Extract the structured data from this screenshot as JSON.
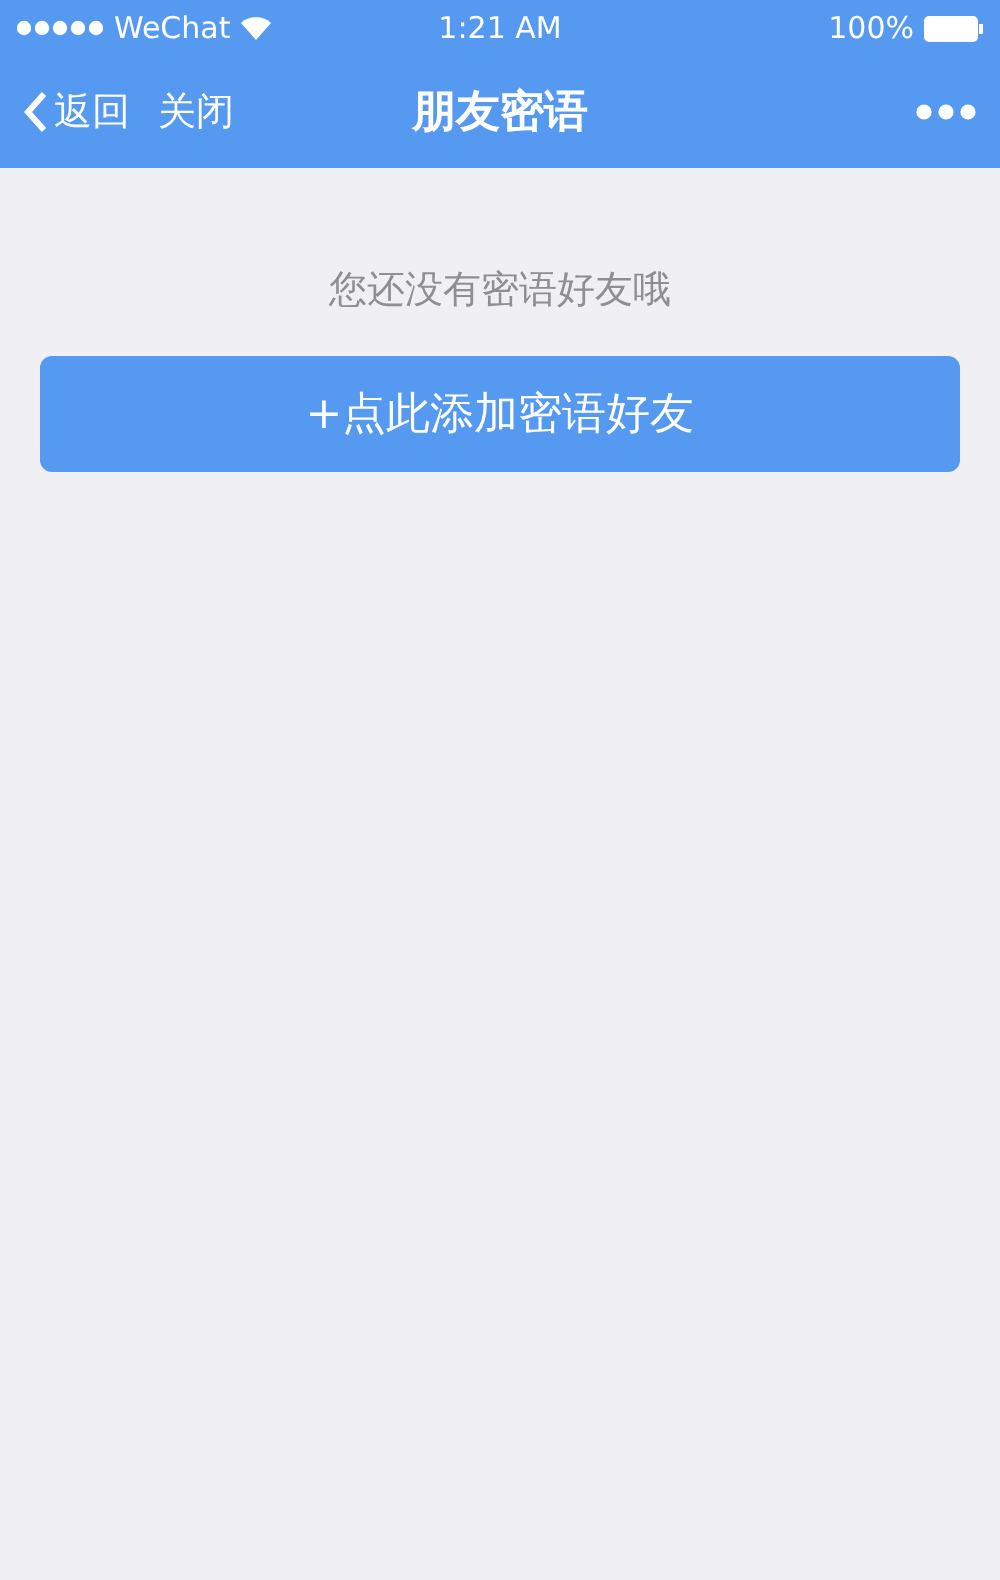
{
  "status_bar": {
    "carrier": "WeChat",
    "time": "1:21 AM",
    "battery": "100%"
  },
  "nav_bar": {
    "back": "返回",
    "close": "关闭",
    "title": "朋友密语"
  },
  "empty_message": "您还没有密语好友哦",
  "add_button": "+点此添加密语好友"
}
